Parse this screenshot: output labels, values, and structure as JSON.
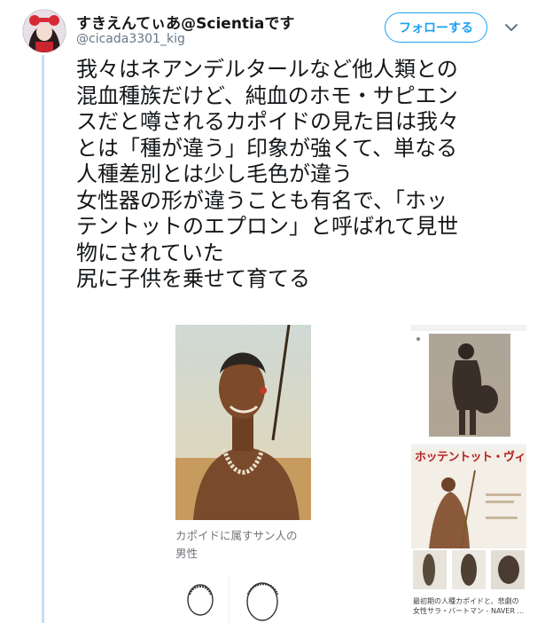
{
  "tweet": {
    "display_name": "すきえんてぃあ@Scientiaです",
    "handle": "@cicada3301_kig",
    "follow_label": "フォローする",
    "text_lines": [
      "我々はネアンデルタールなど他人類との",
      "混血種族だけど、純血のホモ・サピエン",
      "スだと噂されるカポイドの見た目は我々",
      "とは「種が違う」印象が強くて、単なる",
      "人種差別とは少し毛色が違う",
      "女性器の形が違うことも有名で、「ホッ",
      "テントットのエプロン」と呼ばれて見世",
      "物にされていた",
      "尻に子供を乗せて育てる"
    ]
  },
  "media": {
    "caption_left_line1": "カポイドに属すサン人の",
    "caption_left_line2": "男性",
    "book_title": "ホッテントット・ヴィーナス",
    "caption_right_line1": "最初期の人種カポイドと、悲劇の",
    "caption_right_line2": "女性サラ・バートマン - NAVER ..."
  },
  "icons": {
    "caret": "chevron-down-icon",
    "avatar": "avatar"
  },
  "colors": {
    "accent": "#1da1f2",
    "thread_line": "#c4dff6",
    "secondary_text": "#657786"
  }
}
